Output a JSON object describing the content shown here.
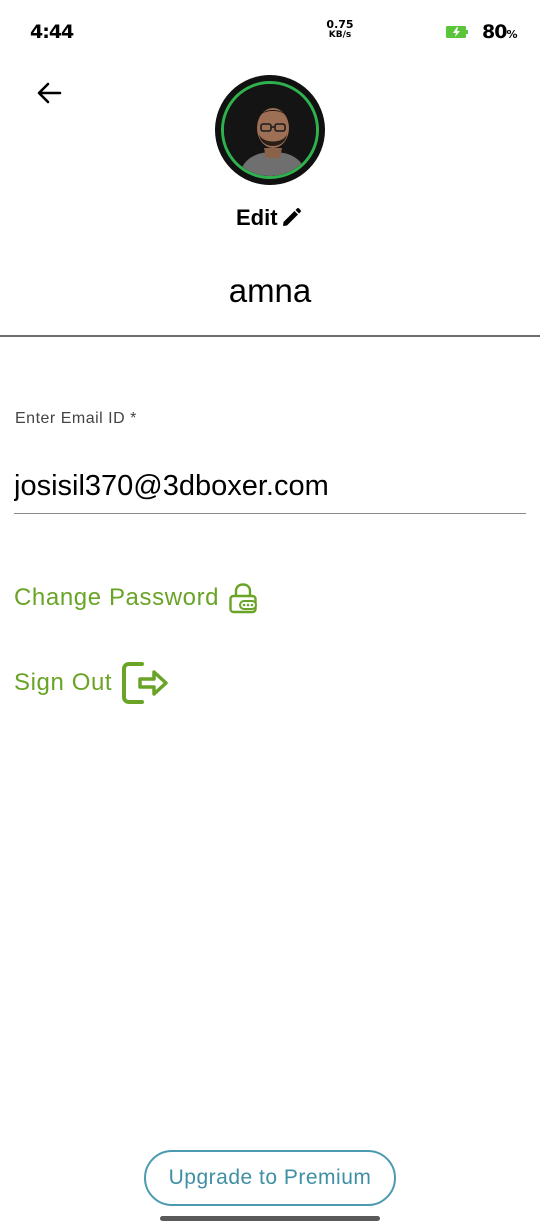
{
  "status_bar": {
    "time": "4:44",
    "net_speed_value": "0.75",
    "net_speed_unit": "KB/s",
    "battery_value": "80",
    "battery_unit": "%",
    "battery_icon": "battery-charging-icon",
    "battery_color": "#5ac43b"
  },
  "header": {
    "back_icon": "arrow-left-icon",
    "edit_label": "Edit",
    "edit_icon": "pencil-icon",
    "user_name": "amna",
    "avatar_ring_color": "#2fb14d"
  },
  "email": {
    "label": "Enter Email ID *",
    "value": "josisil370@3dboxer.com"
  },
  "actions": {
    "change_password_label": "Change Password",
    "change_password_icon": "lock-icon",
    "sign_out_label": "Sign Out",
    "sign_out_icon": "sign-out-icon",
    "accent_color": "#6aa427"
  },
  "footer": {
    "upgrade_label": "Upgrade to Premium",
    "upgrade_color": "#4c9ab0"
  }
}
